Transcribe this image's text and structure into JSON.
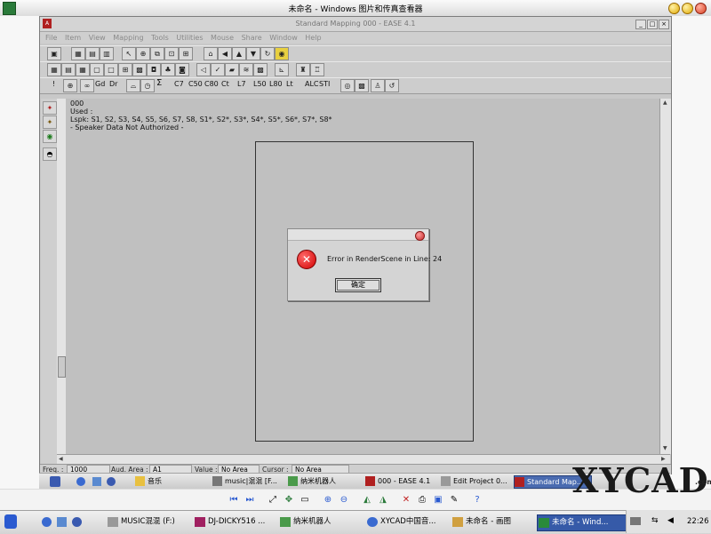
{
  "viewer": {
    "title": "未命名 - Windows 图片和传真查看器"
  },
  "ease": {
    "title": "Standard Mapping 000 - EASE 4.1",
    "menu": [
      "File",
      "Item",
      "View",
      "Mapping",
      "Tools",
      "Utilities",
      "Mouse",
      "Share",
      "Window",
      "Help"
    ],
    "toolbar3_text": [
      "!",
      "Gd",
      "Dr",
      "Σ",
      "C7",
      "C50",
      "C80",
      "Ct",
      "L7",
      "L50",
      "L80",
      "Lt",
      "ALC",
      "STI"
    ],
    "canvas_info": {
      "line1": "000",
      "line2": "Used :",
      "line3": "Lspk: S1, S2, S3, S4, S5, S6, S7, S8, S1*, S2*, S3*, S4*, S5*, S6*, S7*, S8*",
      "line4": "- Speaker Data Not Authorized -"
    },
    "dialog": {
      "message": "Error in RenderScene in Line: 24",
      "ok_label": "确定"
    },
    "status": {
      "freq_label": "Freq. :",
      "freq_value": "1000",
      "aud_label": "Aud. Area :",
      "aud_value": "A1",
      "value_label": "Value :",
      "value_value": "No Area",
      "cursor_label": "Cursor :",
      "cursor_value": "No Area"
    }
  },
  "inner_taskbar": {
    "items": [
      "音乐",
      "music|混混 [F...",
      "纳米机器人",
      "000 - EASE 4.1",
      "Edit Project 0...",
      "Standard Map..."
    ]
  },
  "watermark": {
    "text": "XYCAD",
    "suffix": ".com"
  },
  "os_taskbar": {
    "items": [
      "MUSIC混混 (F:)",
      "DJ-DICKY516 ...",
      "纳米机器人",
      "XYCAD中国音...",
      "未命名 - 画图",
      "未命名 - Wind..."
    ],
    "clock": "22:26"
  },
  "colors": {
    "canvas": "#c0c0c0",
    "active_task": "#365aa8",
    "error_red": "#d10000"
  }
}
